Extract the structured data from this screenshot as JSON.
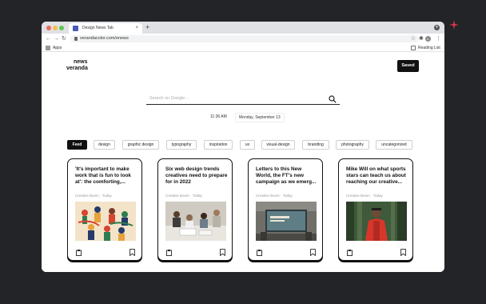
{
  "browser": {
    "tab_title": "Design News Tab",
    "url": "verandacolor.com/enews",
    "profile_initial": "L",
    "bookmarks": {
      "apps_label": "Apps",
      "reading_list_label": "Reading List"
    }
  },
  "header": {
    "logo_line1": "news",
    "logo_line2": "veranda",
    "saved_label": "Saved"
  },
  "search": {
    "placeholder": "Search on Google..."
  },
  "clock": {
    "time": "11:36 AM",
    "date": "Monday, September 13"
  },
  "categories": [
    "Feed",
    "design",
    "graphic design",
    "typography",
    "inspiration",
    "ux",
    "visual-design",
    "branding",
    "photography",
    "uncategorized"
  ],
  "active_category": "Feed",
  "cards": [
    {
      "title": "'It's important to make work that is fun to look at': the comforting,...",
      "source": "Creative Boom",
      "date": "Today",
      "image": "illustration-people"
    },
    {
      "title": "Six web design trends creatives need to prepare for in 2022",
      "source": "Creative Boom",
      "date": "Today",
      "image": "photo-team-desk"
    },
    {
      "title": "Letters to this New World, the FT's new campaign as we emerg...",
      "source": "Creative Boom",
      "date": "Today",
      "image": "photo-billboard"
    },
    {
      "title": "Mike Will on what sports stars can teach us about reaching our creative...",
      "source": "Creative Boom",
      "date": "Today",
      "image": "photo-hiker-forest"
    }
  ],
  "colors": {
    "accent": "#111111",
    "background": "#232427",
    "sparkle": "#e8344e"
  }
}
